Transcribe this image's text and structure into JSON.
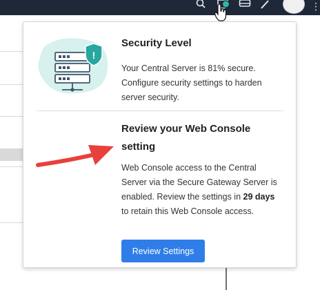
{
  "topbar": {
    "icons": [
      "search-icon",
      "bell-icon",
      "car-icon",
      "pen-icon",
      "avatar",
      "more-icon"
    ],
    "more_glyph": "⋮",
    "bg_color": "#1f2838"
  },
  "popover": {
    "security": {
      "title": "Security Level",
      "body": "Your Central Server is 81% secure. Configure security settings to harden server security."
    },
    "review": {
      "title": "Review your Web Console setting",
      "body_prefix": "Web Console access to the Central Server via the Secure Gateway Server is enabled. Review the settings in ",
      "days": "29 days",
      "body_suffix": " to retain this Web Console access.",
      "button_label": "Review Settings"
    }
  },
  "colors": {
    "accent": "#2f7de8",
    "shield": "#2aa6a0",
    "illustration_bg": "#d6f1ee",
    "arrow": "#e8413c"
  }
}
